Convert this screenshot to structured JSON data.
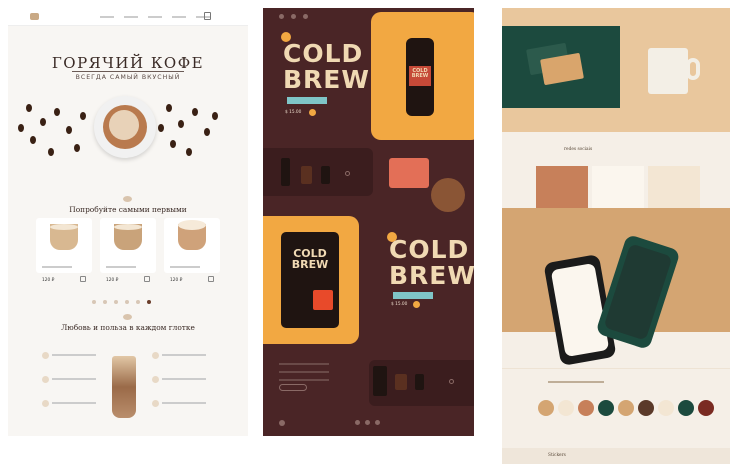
{
  "panel1": {
    "title": "ГОРЯЧИЙ КОФЕ",
    "subtitle": "ВСЕГДА САМЫЙ ВКУСНЫЙ",
    "section1": "Попробуйте самыми первыми",
    "section2": "Любовь и польза в каждом глотке",
    "products": [
      {
        "price": "120 ₽"
      },
      {
        "price": "120 ₽"
      },
      {
        "price": "120 ₽"
      }
    ]
  },
  "panel2": {
    "brew_line1": "COLD",
    "brew_line2": "BREW",
    "price_a": "$ 15.00",
    "price_b": "$ 15.00"
  },
  "panel3": {
    "social_heading": "redes sociais",
    "stickers_heading": "Stickers"
  },
  "colors": {
    "accent_brown": "#4a2526",
    "accent_orange": "#f2a842",
    "accent_green": "#1c4a3e",
    "tan": "#e9c79d"
  }
}
